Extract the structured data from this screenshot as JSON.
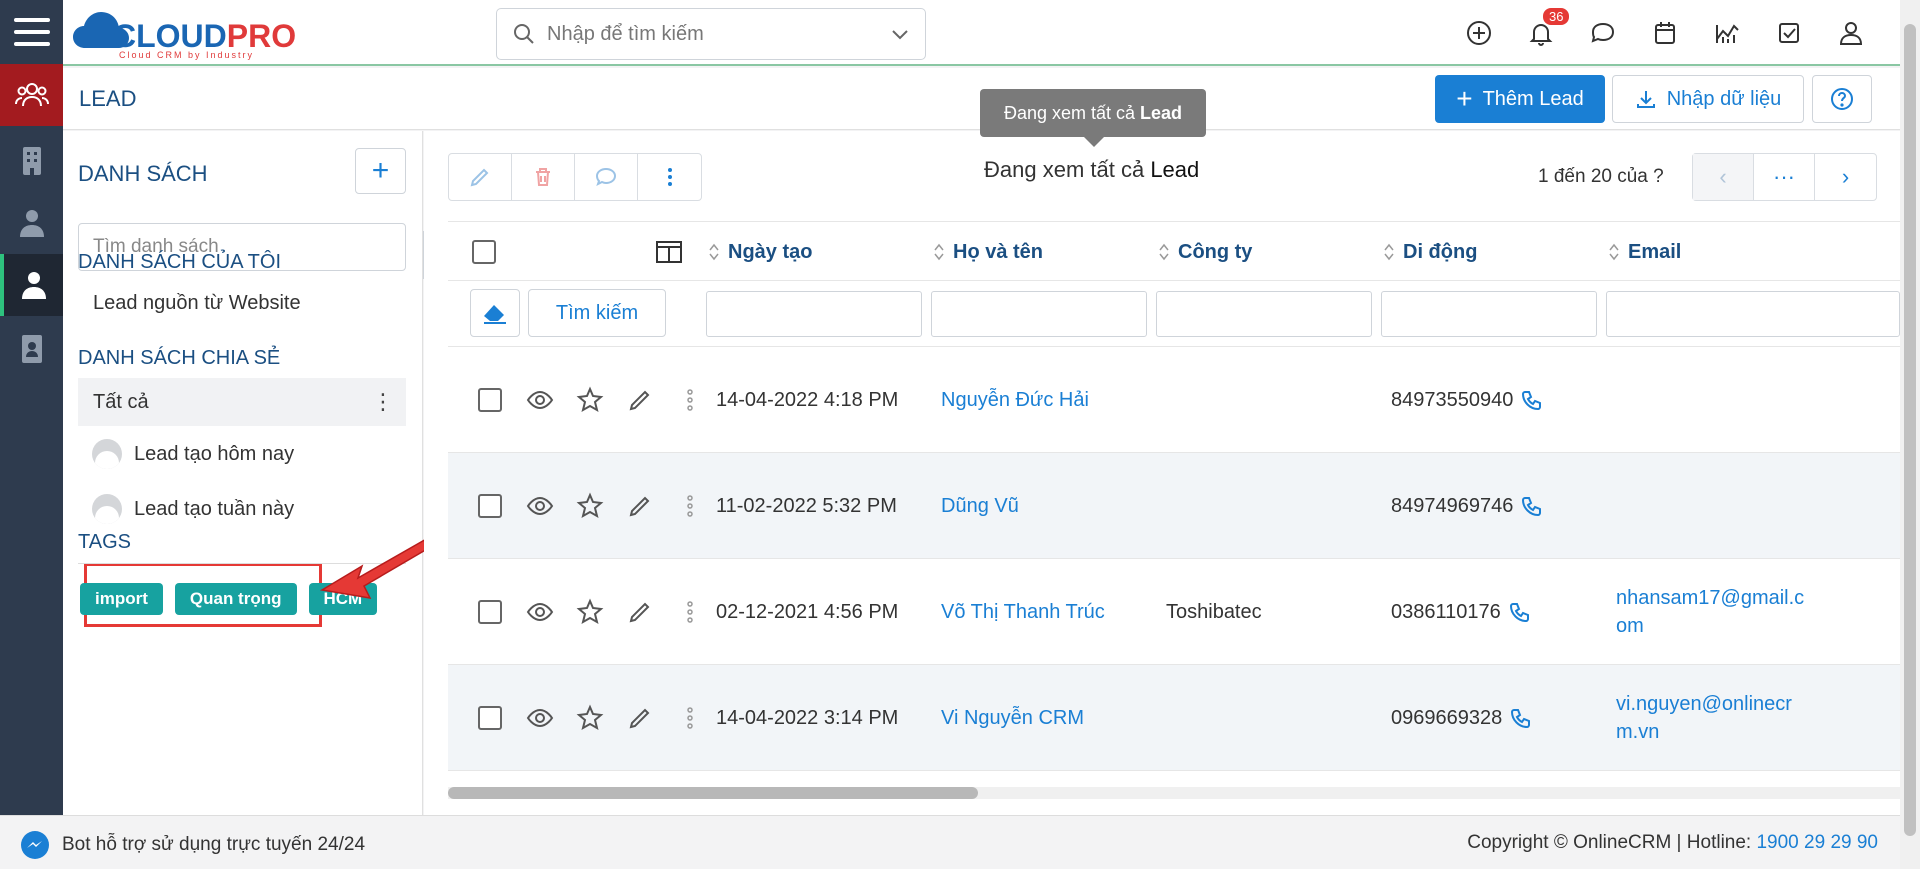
{
  "colors": {
    "accent": "#1a7fd4",
    "heading": "#1b4f82",
    "rail": "#2e3b4e",
    "rail_active": "#a31b1f",
    "tag": "#17a2a0",
    "highlight": "#e53935"
  },
  "brand": {
    "name_cloud": "CLOUD",
    "name_pro": "PRO",
    "tagline": "Cloud CRM by Industry"
  },
  "search": {
    "placeholder": "Nhập để tìm kiếm"
  },
  "header": {
    "notification_count": "36"
  },
  "page": {
    "title": "LEAD",
    "add_button": "Thêm Lead",
    "import_button": "Nhập dữ liệu"
  },
  "lists": {
    "heading": "DANH SÁCH",
    "search_placeholder": "Tìm danh sách",
    "my_lists_heading": "DANH SÁCH CỦA TÔI",
    "my_lists": [
      "Lead nguồn từ Website"
    ],
    "shared_heading": "DANH SÁCH CHIA SẺ",
    "shared": [
      "Tất cả",
      "Lead tạo hôm nay",
      "Lead tạo tuần này"
    ],
    "tags_heading": "TAGS",
    "tags": [
      "import",
      "Quan trọng",
      "HCM"
    ]
  },
  "toolbar": {
    "viewing_prefix": "Đang xem tất cả",
    "viewing_entity": "Lead",
    "tooltip_prefix": "Đang xem tất cả",
    "tooltip_entity": "Lead",
    "pager_text": "1 đến 20 của",
    "pager_unknown": "?",
    "pager_more": "···"
  },
  "table": {
    "columns": [
      "Ngày tạo",
      "Họ và tên",
      "Công ty",
      "Di động",
      "Email"
    ],
    "search_button": "Tìm kiếm",
    "rows": [
      {
        "created": "14-04-2022 4:18 PM",
        "name": "Nguyễn Đức Hải",
        "company": "",
        "mobile": "84973550940",
        "email": ""
      },
      {
        "created": "11-02-2022 5:32 PM",
        "name": "Dũng Vũ",
        "company": "",
        "mobile": "84974969746",
        "email": ""
      },
      {
        "created": "02-12-2021 4:56 PM",
        "name": "Võ Thị Thanh Trúc",
        "company": "Toshibatec",
        "mobile": "0386110176",
        "email": "nhansam17@gmail.com"
      },
      {
        "created": "14-04-2022 3:14 PM",
        "name": "Vi Nguyễn CRM",
        "company": "",
        "mobile": "0969669328",
        "email": "vi.nguyen@onlinecrm.vn"
      }
    ]
  },
  "footer": {
    "bot_text": "Bot hỗ trợ sử dụng trực tuyến 24/24",
    "copyright": "Copyright © OnlineCRM | Hotline:",
    "hotline": "1900 29 29 90"
  }
}
